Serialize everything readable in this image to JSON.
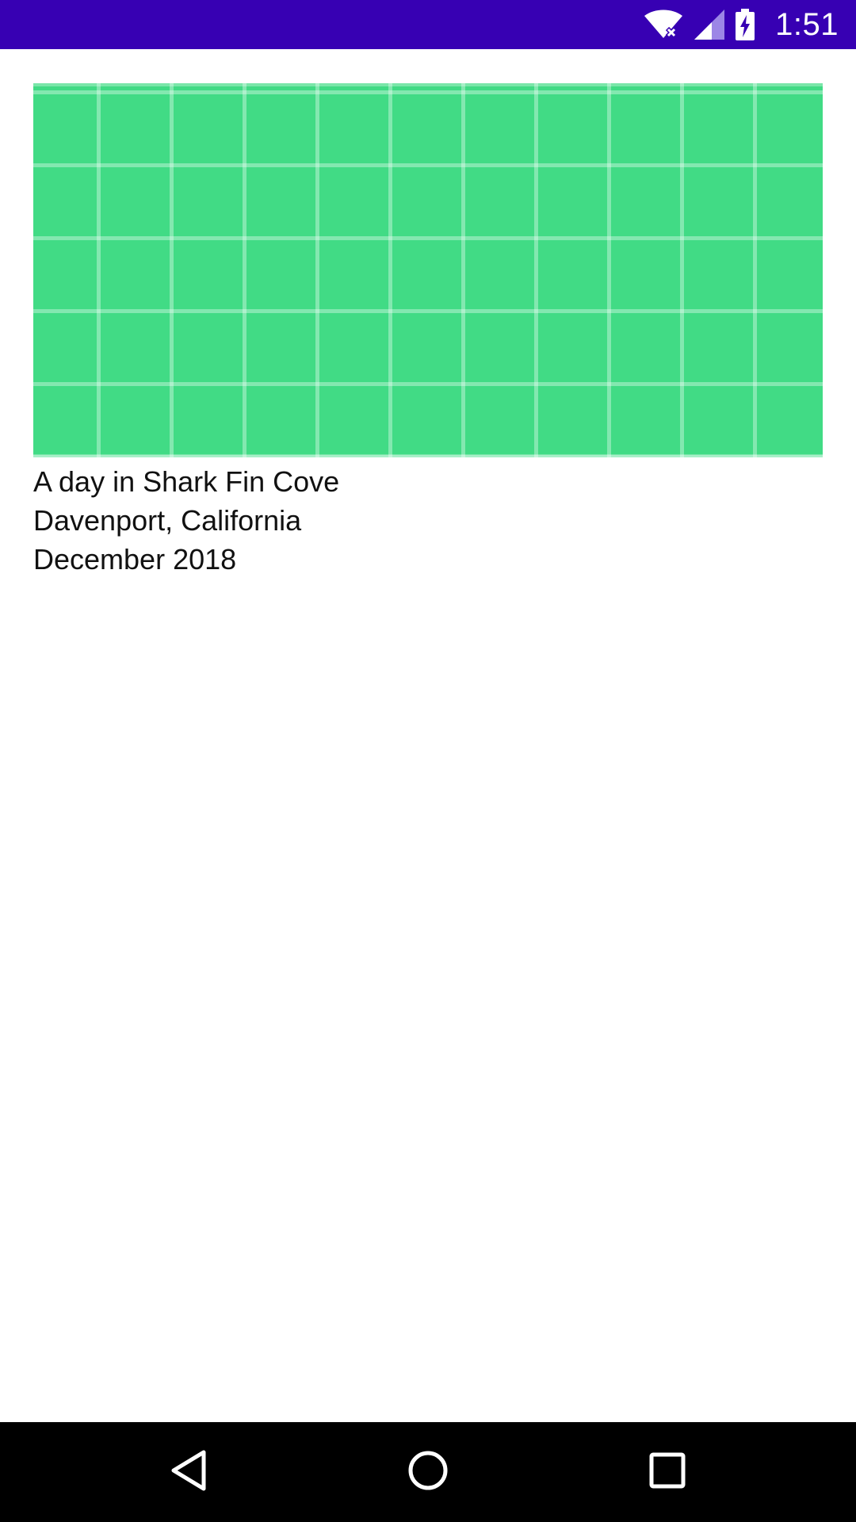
{
  "status_bar": {
    "time": "1:51",
    "background_color": "#3700B3",
    "icons": [
      "wifi-icon",
      "cell-signal-icon",
      "battery-charging-icon"
    ]
  },
  "card": {
    "image_color": "#41DB85",
    "lines": [
      "A day in Shark Fin Cove",
      "Davenport, California",
      "December 2018"
    ]
  },
  "nav_bar": {
    "icons": [
      "back-icon",
      "home-icon",
      "recents-icon"
    ]
  }
}
